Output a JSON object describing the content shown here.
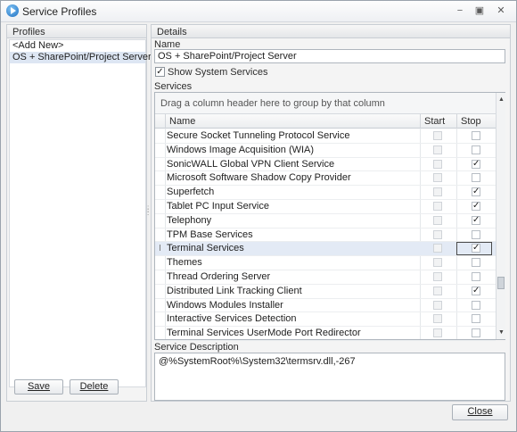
{
  "window": {
    "title": "Service Profiles",
    "icon": "play-icon",
    "controls": {
      "minimize": "−",
      "maximize": "▣",
      "close": "✕"
    }
  },
  "profiles": {
    "header": "Profiles",
    "items": [
      "<Add New>",
      "OS + SharePoint/Project Server"
    ],
    "selected_index": 1,
    "save_label": "Save",
    "delete_label": "Delete"
  },
  "details": {
    "header": "Details",
    "name_label": "Name",
    "name_value": "OS + SharePoint/Project Server",
    "show_system_label": "Show System Services",
    "show_system_checked": true,
    "services_label": "Services",
    "group_hint": "Drag a column header here to group by that column",
    "columns": {
      "name": "Name",
      "start": "Start",
      "stop": "Stop"
    },
    "selected_row_index": 8,
    "services": [
      {
        "name": "Secure Socket Tunneling Protocol Service",
        "start": false,
        "stop": false
      },
      {
        "name": "Windows Image Acquisition (WIA)",
        "start": false,
        "stop": false
      },
      {
        "name": "SonicWALL Global VPN Client Service",
        "start": false,
        "stop": true
      },
      {
        "name": "Microsoft Software Shadow Copy Provider",
        "start": false,
        "stop": false
      },
      {
        "name": "Superfetch",
        "start": false,
        "stop": true
      },
      {
        "name": "Tablet PC Input Service",
        "start": false,
        "stop": true
      },
      {
        "name": "Telephony",
        "start": false,
        "stop": true
      },
      {
        "name": "TPM Base Services",
        "start": false,
        "stop": false
      },
      {
        "name": "Terminal Services",
        "start": false,
        "stop": true
      },
      {
        "name": "Themes",
        "start": false,
        "stop": false
      },
      {
        "name": "Thread Ordering Server",
        "start": false,
        "stop": false
      },
      {
        "name": "Distributed Link Tracking Client",
        "start": false,
        "stop": true
      },
      {
        "name": "Windows Modules Installer",
        "start": false,
        "stop": false
      },
      {
        "name": "Interactive Services Detection",
        "start": false,
        "stop": false
      },
      {
        "name": "Terminal Services UserMode Port Redirector",
        "start": false,
        "stop": false
      }
    ],
    "description_label": "Service Description",
    "description_value": "@%SystemRoot%\\System32\\termsrv.dll,-267"
  },
  "footer": {
    "close_label": "Close"
  },
  "colors": {
    "selection": "#dde6f3",
    "accent": "#1e6fc0"
  }
}
